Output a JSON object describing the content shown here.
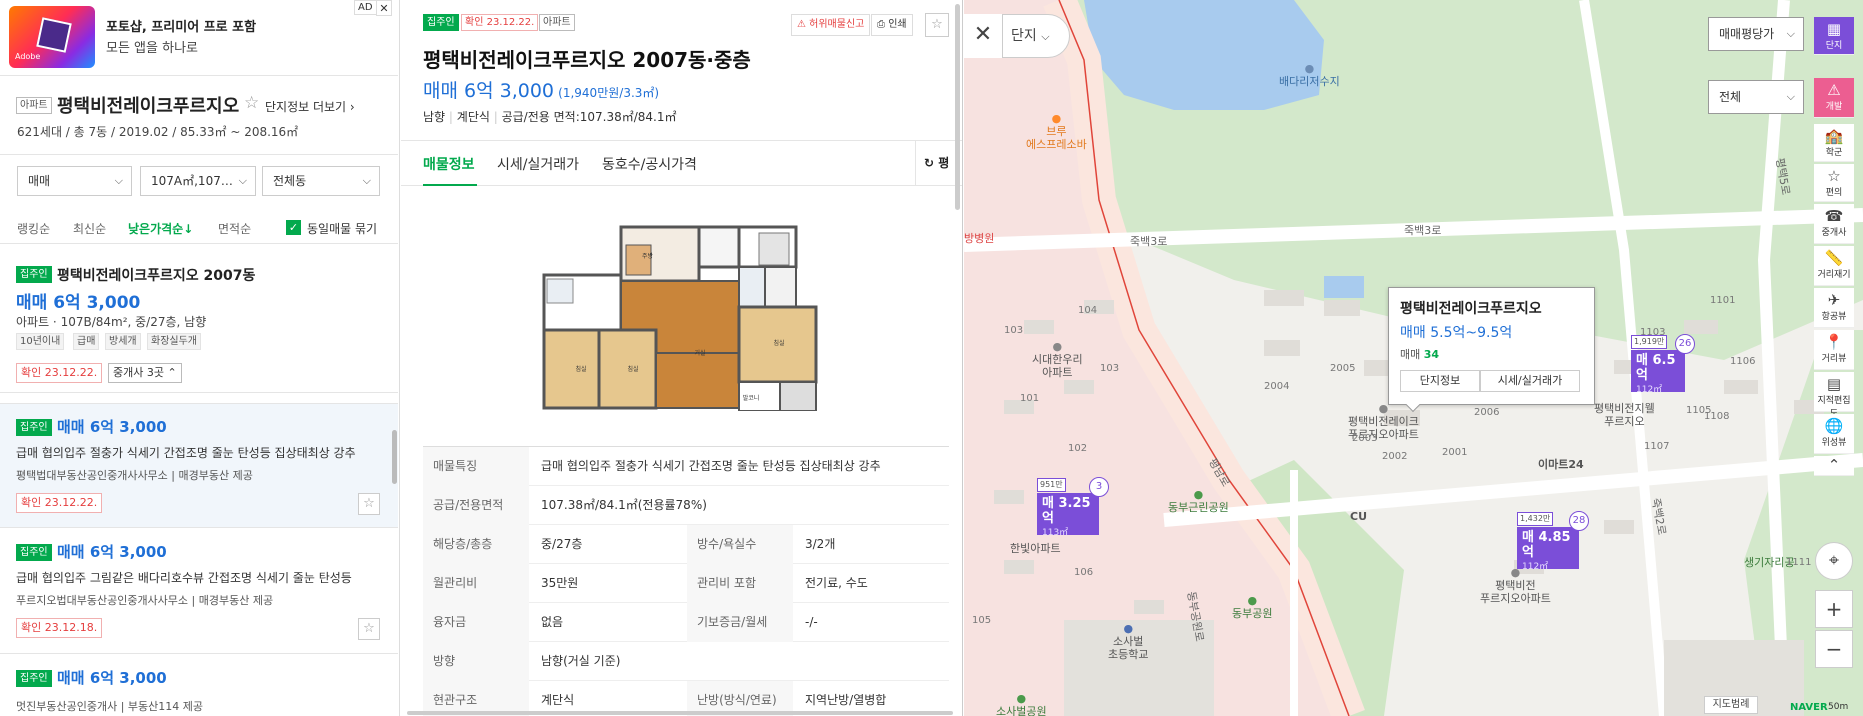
{
  "ad": {
    "title": "포토샵, 프리미어 프로 포함",
    "subtitle": "모든 앱을 하나로",
    "ad_label": "AD",
    "close": "✕",
    "logo_text": "Adobe"
  },
  "complex": {
    "type_tag": "아파트",
    "name": "평택비전레이크푸르지오",
    "more_link": "단지정보 더보기",
    "summary": "621세대 / 총 7동 / 2019.02 / 85.33㎡ ~ 208.16㎡"
  },
  "filters": {
    "trade": "매매",
    "area": "107A㎡,107…",
    "building": "전체동"
  },
  "sort": {
    "options": [
      "랭킹순",
      "최신순",
      "낮은가격순↓",
      "면적순"
    ],
    "active": "낮은가격순↓",
    "group_label": "동일매물 묶기"
  },
  "listings": [
    {
      "tag": "집주인",
      "title": "평택비전레이크푸르지오 2007동",
      "price": "매매 6억 3,000",
      "info": "아파트 · 107B/84m², 중/27층, 남향",
      "keywords": [
        "10년이내",
        "급매",
        "방세개",
        "화장실두개"
      ],
      "confirm": "확인 23.12.22.",
      "agent_btn": "중개사 3곳"
    },
    {
      "tag": "집주인",
      "price": "매매 6억 3,000",
      "desc": "급매 협의입주 절충가 식세기 간접조명 줄눈 탄성등 집상태최상 강추",
      "agent": "평택법대부동산공인중개사사무소",
      "provider": "매경부동산 제공",
      "confirm": "확인 23.12.22."
    },
    {
      "tag": "집주인",
      "price": "매매 6억 3,000",
      "desc": "급매 협의입주 그림같은 배다리호수뷰 간접조명 식세기 줄눈 탄성등",
      "agent": "푸르지오법대부동산공인중개사사무소",
      "provider": "매경부동산 제공",
      "confirm": "확인 23.12.18."
    },
    {
      "tag": "집주인",
      "price": "매매 6억 3,000",
      "agent": "멋진부동산공인중개사",
      "provider": "부동산114 제공"
    }
  ],
  "detail": {
    "tags": [
      "집주인",
      "확인 23.12.22.",
      "아파트"
    ],
    "report_btn": "허위매물신고",
    "print_btn": "인쇄",
    "title": "평택비전레이크푸르지오 2007동·중층",
    "price": "매매 6억 3,000",
    "price_per": "(1,940만원/3.3㎡)",
    "meta": [
      "남향",
      "계단식",
      "공급/전용 면적:107.38㎡/84.1㎡"
    ],
    "tabs": [
      "매물정보",
      "시세/실거래가",
      "동호수/공시가격"
    ],
    "active_tab": "매물정보",
    "right_tab": "평",
    "floorplan_rooms": [
      "주방/식당",
      "침실",
      "침실",
      "거실",
      "침실",
      "드레스룸",
      "욕실",
      "발코니",
      "현관"
    ],
    "table": [
      {
        "k1": "매물특징",
        "v1": "급매 협의입주 절충가 식세기 간접조명 줄눈 탄성등 집상태최상 강추"
      },
      {
        "k1": "공급/전용면적",
        "v1": "107.38㎡/84.1㎡(전용률78%)"
      },
      {
        "k1": "해당층/총층",
        "v1": "중/27층",
        "k2": "방수/욕실수",
        "v2": "3/2개"
      },
      {
        "k1": "월관리비",
        "v1": "35만원",
        "k2": "관리비 포함",
        "v2": "전기료, 수도"
      },
      {
        "k1": "융자금",
        "v1": "없음",
        "k2": "기보증금/월세",
        "v2": "-/-"
      },
      {
        "k1": "방향",
        "v1": "남향(거실 기준)"
      },
      {
        "k1": "현관구조",
        "v1": "계단식",
        "k2": "난방(방식/연료)",
        "v2": "지역난방/열병합"
      }
    ]
  },
  "map": {
    "top_control": "단지",
    "close": "✕",
    "select1": "매매평당가",
    "select2": "전체",
    "side_buttons": [
      {
        "icon": "▦",
        "label": "단지"
      },
      {
        "icon": "⚠",
        "label": "개발"
      },
      {
        "icon": "🏫",
        "label": "학군"
      },
      {
        "icon": "☆",
        "label": "편의"
      },
      {
        "icon": "☎",
        "label": "중개사"
      },
      {
        "icon": "📏",
        "label": "거리재기"
      },
      {
        "icon": "✈",
        "label": "항공뷰"
      },
      {
        "icon": "📍",
        "label": "거리뷰"
      },
      {
        "icon": "▤",
        "label": "지적편집도"
      },
      {
        "icon": "🌐",
        "label": "위성뷰"
      },
      {
        "icon": "⌃",
        "label": ""
      }
    ],
    "popup": {
      "title": "평택비전레이크푸르지오",
      "price_range": "매매 5.5억~9.5억",
      "count_label": "매매",
      "count": "34",
      "btn1": "단지정보",
      "btn2": "시세/실거래가"
    },
    "markers": [
      {
        "top": "1,919만",
        "price": "매 6.5억",
        "area": "112㎡",
        "count": "26"
      },
      {
        "top": "951만",
        "price": "매 3.25억",
        "area": "113㎡",
        "count": "3"
      },
      {
        "top": "1,432만",
        "price": "매 4.85억",
        "area": "112㎡",
        "count": "28"
      }
    ],
    "labels": {
      "lake": "배다리저수지",
      "brew": "브루\n에스프레소바",
      "hospital": "방병원",
      "road1": "죽백3로",
      "road2": "죽백3로",
      "road3": "평남로",
      "road4": "동부공원로",
      "road5": "죽백2로",
      "road6": "평택5로",
      "apt1": "시대한우리\n아파트",
      "apt2": "평택비전레이크\n푸르지오아파트",
      "apt3": "평택비전지웰\n푸르지오",
      "apt4": "한빛아파트",
      "apt5": "평택비전\n푸르지오아파트",
      "emart": "이마트24",
      "cu": "CU",
      "park1": "동부근린공원",
      "park2": "동부공원",
      "school": "소사벌\n초등학교",
      "park3": "소사벌공원",
      "sports": "생기자리공",
      "bldg": [
        "103",
        "104",
        "101",
        "103",
        "102",
        "105",
        "106",
        "2004",
        "2005",
        "2003",
        "2002",
        "2001",
        "2006",
        "1101",
        "1106",
        "1102",
        "1103",
        "1104",
        "1105",
        "1107",
        "1108",
        "1111"
      ]
    },
    "zoom_in": "+",
    "zoom_out": "−",
    "legend_btn": "지도범례",
    "naver": "NAVER",
    "scale": "50m"
  }
}
